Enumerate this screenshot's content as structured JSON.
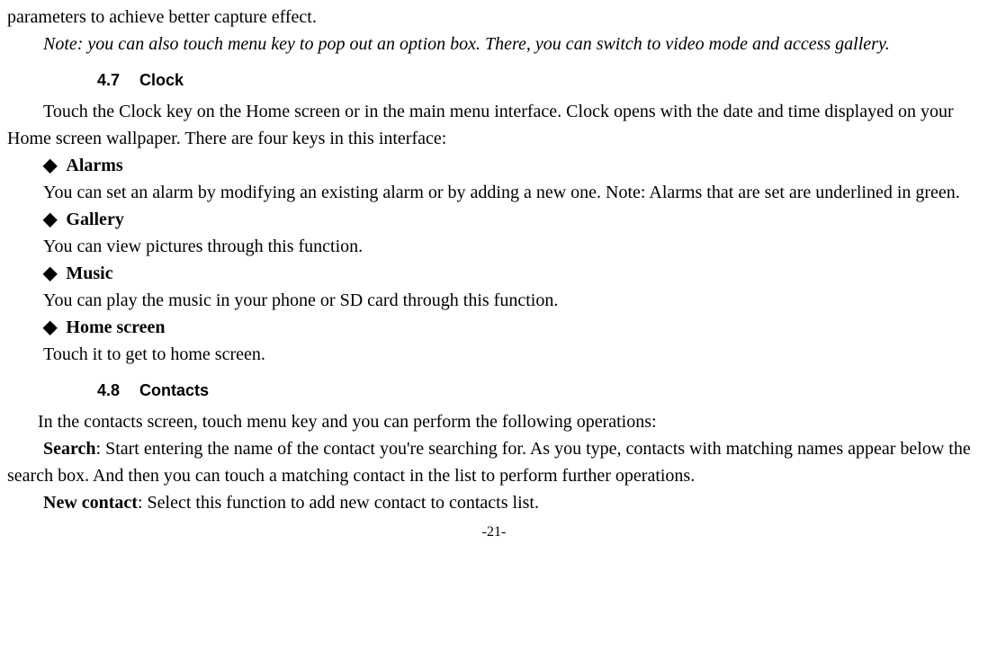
{
  "page": {
    "partial_line": "parameters to achieve better capture effect.",
    "note": "Note: you can also touch menu key to pop out an option box. There, you can switch to video mode and access gallery.",
    "section_47": {
      "num": "4.7",
      "title": "Clock",
      "intro": "Touch the Clock key on the Home screen or in the main menu interface. Clock opens with the date and time displayed on your Home screen wallpaper. There are four keys in this interface:",
      "alarms": {
        "title": "Alarms",
        "desc": "You can set an alarm by modifying an existing alarm or by adding a new one. Note: Alarms that are set are underlined in green."
      },
      "gallery": {
        "title": "Gallery",
        "desc": "You can view pictures through this function."
      },
      "music": {
        "title": "Music",
        "desc": "You can play the music in your phone or SD card through this function."
      },
      "home": {
        "title": "Home screen",
        "desc": "Touch it to get to home screen."
      }
    },
    "section_48": {
      "num": "4.8",
      "title": "Contacts",
      "intro": "In the contacts screen, touch menu key and you can perform the following operations:",
      "search_label": "Search",
      "search_desc": ": Start entering the name of the contact you're searching for. As you type, contacts with matching names appear below the search box. And then you can touch a matching contact in the list to perform further operations.",
      "newcontact_label": "New contact",
      "newcontact_desc": ": Select this function to add new contact to contacts list."
    },
    "footer": "-21-"
  }
}
